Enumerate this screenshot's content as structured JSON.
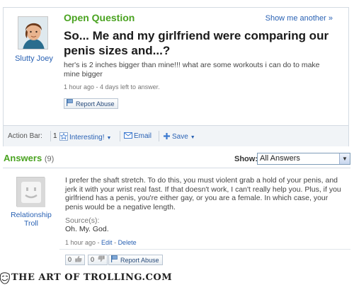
{
  "question": {
    "heading": "Open Question",
    "show_another": "Show me another »",
    "asker_name": "Slutty Joey",
    "title": "So... Me and my girlfriend were comparing our penis sizes and...?",
    "body": "her's is 2 inches bigger than mine!!! what are some workouts i can do to make mine bigger",
    "meta": "1 hour ago - 4 days left to answer.",
    "report_label": "Report Abuse"
  },
  "action_bar": {
    "label": "Action Bar:",
    "interesting_count": "1",
    "interesting_label": "Interesting!",
    "email_label": "Email",
    "save_label": "Save"
  },
  "answers": {
    "title": "Answers",
    "count": "(9)",
    "show_label": "Show:",
    "show_selected": "All Answers"
  },
  "answer": {
    "author": "Relationship Troll",
    "body": "I prefer the shaft stretch. To do this, you must violent grab a hold of your penis, and jerk it with your wrist real fast. If that doesn't work, I can't really help you. Plus, if you girlfriend has a penis, you're either gay, or you are a female. In which case, your penis would be a negative length.",
    "source_label": "Source(s):",
    "source_text": "Oh. My. God.",
    "meta_time": "1 hour ago",
    "meta_edit": "Edit",
    "meta_delete": "Delete",
    "thumbs_up_count": "0",
    "thumbs_down_count": "0",
    "report_label": "Report Abuse"
  },
  "footer": {
    "text": "THE ART OF TROLLING.COM"
  },
  "colors": {
    "accent_green": "#4aa321",
    "link_blue": "#2a62b4"
  },
  "icons": {
    "interesting": "star-icon",
    "email": "envelope-icon",
    "save": "plus-icon",
    "report": "flag-icon",
    "thumbs_up": "thumbs-up-icon",
    "thumbs_down": "thumbs-down-icon"
  }
}
